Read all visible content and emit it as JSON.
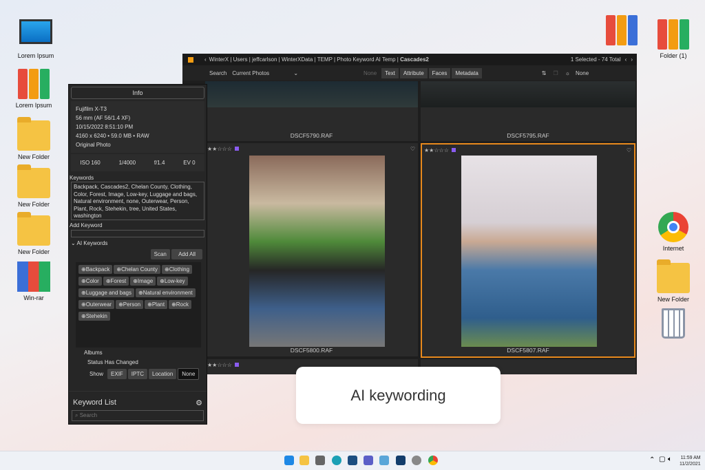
{
  "desktop": {
    "left": [
      {
        "label": "Lorem Ipsum",
        "icon": "computer"
      },
      {
        "label": "Lorem Ipsum",
        "icon": "binders"
      },
      {
        "label": "New Folder",
        "icon": "folder"
      },
      {
        "label": "New Folder",
        "icon": "folder"
      },
      {
        "label": "New Folder",
        "icon": "folder"
      },
      {
        "label": "Win-rar",
        "icon": "winrar"
      }
    ],
    "right": [
      {
        "label": "Folder (1)",
        "icon": "binders"
      },
      {
        "label": "Internet",
        "icon": "chrome"
      },
      {
        "label": "New Folder",
        "icon": "folder"
      }
    ]
  },
  "app": {
    "breadcrumb": [
      "WinterX",
      "Users",
      "jeffcarlson",
      "WinterXData",
      "TEMP",
      "Photo Keyword AI Temp",
      "Cascades2"
    ],
    "selection": "1 Selected - 74 Total",
    "search_label": "Search",
    "search_scope": "Current Photos",
    "search_modes": [
      "None",
      "Text",
      "Attribute",
      "Faces",
      "Metadata"
    ],
    "filter_value": "None",
    "photos": [
      {
        "name": "DSCF5790.RAF"
      },
      {
        "name": "DSCF5795.RAF"
      },
      {
        "name": "DSCF5800.RAF",
        "rating": "★★☆☆☆"
      },
      {
        "name": "DSCF5807.RAF",
        "rating": "★★☆☆☆",
        "selected": true
      },
      {
        "rating": "★★☆☆☆"
      }
    ]
  },
  "info": {
    "title": "Info",
    "camera": "Fujifilm X-T3",
    "lens": "56 mm (AF 56/1.4 XF)",
    "date": "10/15/2022 8:51:10 PM",
    "size": "4160 x 6240 • 59.0 MB • RAW",
    "type": "Original Photo",
    "exif": [
      "ISO 160",
      "1/4000",
      "f/1.4",
      "EV 0"
    ],
    "keywords_label": "Keywords",
    "keywords": "Backpack, Cascades2, Chelan County, Clothing, Color, Forest, Image, Low-key, Luggage and bags, Natural environment, none, Outerwear, Person, Plant, Rock, Stehekin, tree, United States, washington",
    "add_keyword_label": "Add Keyword",
    "ai_label": "AI Keywords",
    "scan": "Scan",
    "add_all": "Add All",
    "ai_keywords": [
      "Backpack",
      "Chelan County",
      "Clothing",
      "Color",
      "Forest",
      "Image",
      "Low-key",
      "Luggage and bags",
      "Natural environment",
      "Outerwear",
      "Person",
      "Plant",
      "Rock",
      "Stehekin"
    ],
    "albums": "Albums",
    "status": "Status Has Changed",
    "show_label": "Show",
    "show_options": [
      "EXIF",
      "IPTC",
      "Location",
      "None"
    ],
    "keyword_list": "Keyword List",
    "search_placeholder": "Search"
  },
  "caption": "AI keywording",
  "taskbar": {
    "time": "11:59 AM",
    "date": "11/2/2021"
  }
}
